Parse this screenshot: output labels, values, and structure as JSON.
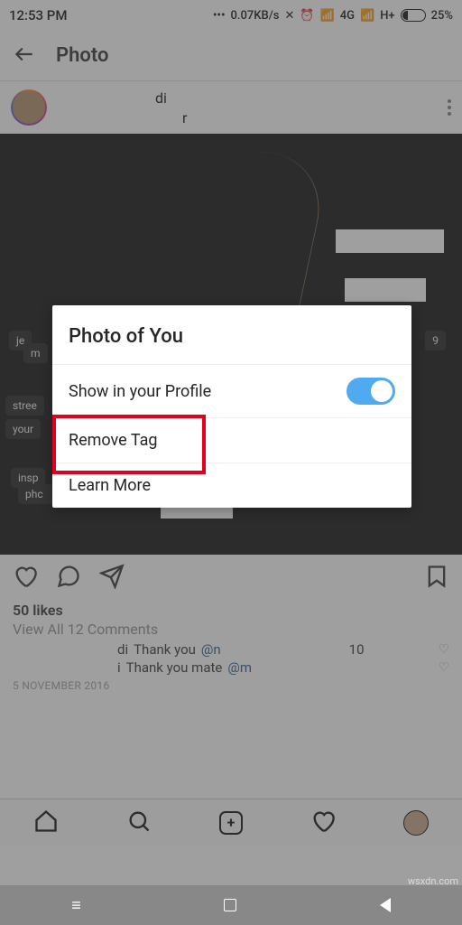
{
  "status": {
    "time": "12:53 PM",
    "speed": "0.07KB/s",
    "net1": "4G",
    "net2": "H+",
    "battery": "25%"
  },
  "header": {
    "title": "Photo"
  },
  "user": {
    "name_suffix": "di",
    "location_suffix": "r"
  },
  "actions": {
    "likes": "50 likes",
    "view_comments": "View All 12 Comments",
    "date": "5 NOVEMBER 2016"
  },
  "comments": [
    {
      "name_suffix": "di",
      "text": "Thank you ",
      "mention": "@n",
      "mention_suffix": "10"
    },
    {
      "name_suffix": "i",
      "text": "Thank you mate ",
      "mention": "@m"
    }
  ],
  "modal": {
    "title": "Photo of You",
    "show_label": "Show in your Profile",
    "remove": "Remove Tag",
    "learn": "Learn More"
  },
  "watermark": "wsxdn.com"
}
